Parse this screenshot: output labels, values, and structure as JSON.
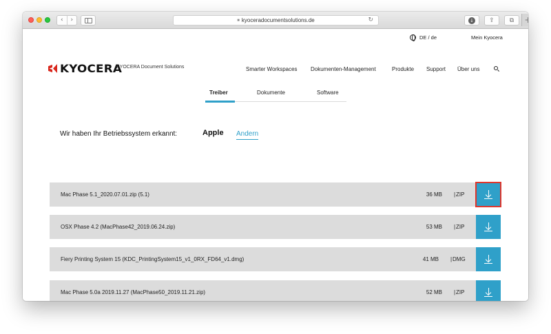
{
  "browser": {
    "url": "kyoceradocumentsolutions.de",
    "back_glyph": "‹",
    "forward_glyph": "›",
    "reload_glyph": "↻",
    "new_tab_glyph": "+",
    "download_glyph": "↓",
    "share_glyph": "⇪",
    "tabs_glyph": "⧉"
  },
  "header": {
    "language": "DE / de",
    "account_link": "Mein Kyocera",
    "logo_text": "KYOCERA",
    "brand_subtitle": "KYOCERA Document Solutions",
    "nav": [
      "Smarter Workspaces",
      "Dokumenten-Management",
      "Produkte",
      "Support",
      "Über uns"
    ]
  },
  "subtabs": {
    "items": [
      "Treiber",
      "Dokumente",
      "Software"
    ],
    "active_index": 0
  },
  "detection": {
    "text": "Wir haben Ihr Betriebssystem erkannt:",
    "os": "Apple",
    "change_link": "Andern"
  },
  "downloads": [
    {
      "name": "Mac Phase 5.1_2020.07.01.zip (5.1)",
      "size": "36 MB",
      "separator": "|",
      "type": "ZIP"
    },
    {
      "name": "OSX Phase 4.2 (MacPhase42_2019.06.24.zip)",
      "size": "53 MB",
      "separator": "|",
      "type": "ZIP"
    },
    {
      "name": "Fiery Printing System 15 (KDC_PrintingSystem15_v1_0RX_FD64_v1.dmg)",
      "size": "41 MB",
      "separator": "|",
      "type": "DMG"
    },
    {
      "name": "Mac Phase 5.0a 2019.11.27 (MacPhase50_2019.11.21.zip)",
      "size": "52 MB",
      "separator": "|",
      "type": "ZIP"
    }
  ],
  "colors": {
    "accent": "#2fa0c9",
    "row_background": "#dcdcdc",
    "brand_red": "#d9261c",
    "focus_outline": "#e0352b"
  }
}
